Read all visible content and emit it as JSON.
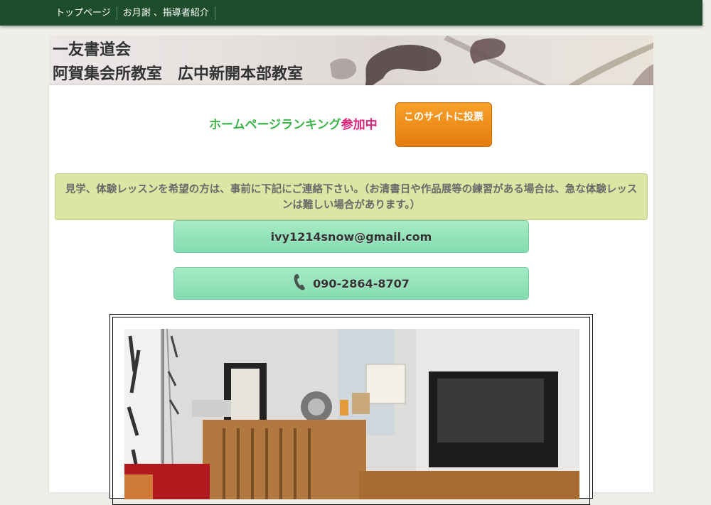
{
  "nav": {
    "items": [
      "トップページ",
      "お月謝 、指導者紹介"
    ]
  },
  "banner": {
    "title": "一友書道会\n阿賀集会所教室　広中新開本部教室"
  },
  "ranking": {
    "green_text": "ホームページランキング",
    "pink_text": "参加中",
    "vote_button": "このサイトに投票"
  },
  "notice": {
    "text": "見学、体験レッスンを希望の方は、事前に下記にご連絡下さい。（お清書日や作品展等の練習がある場合は、急な体験レッスンは難しい場合があります。）"
  },
  "contact": {
    "email": "ivy1214snow@gmail.com",
    "phone": "090-2864-8707"
  },
  "icons": {
    "phone": "phone-handset-icon"
  },
  "colors": {
    "nav_bg": "#1e4d2b",
    "ranking_green": "#3bb54a",
    "ranking_pink": "#e0247b",
    "vote_orange": "#f29423",
    "notice_bg": "#dbe6a4",
    "contact_green": "#96e3bb"
  }
}
